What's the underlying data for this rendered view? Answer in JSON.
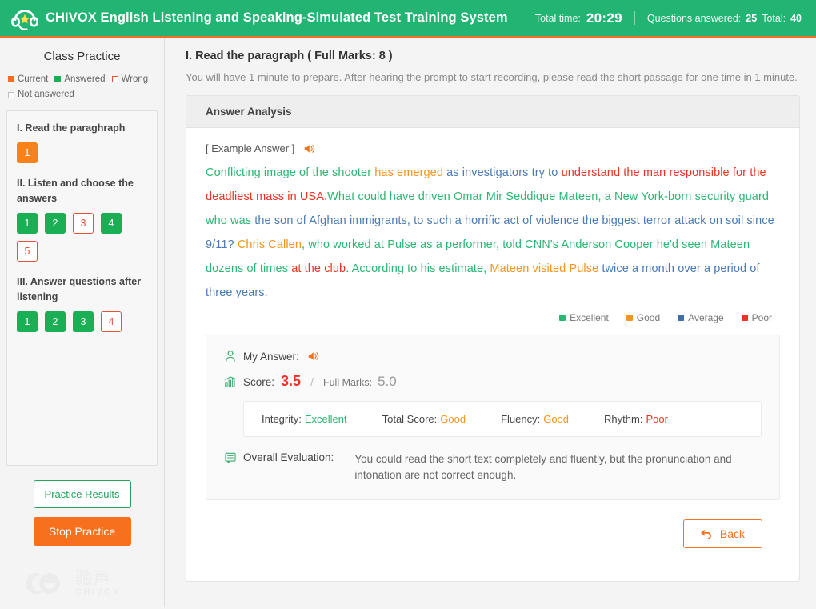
{
  "header": {
    "logo_icon": "headset-icon",
    "app_title": "CHIVOX English Listening and Speaking-Simulated Test Training System",
    "total_time_label": "Total time:",
    "total_time_value": "20:29",
    "questions_answered_label": "Questions answered:",
    "questions_answered_value": "25",
    "total_label": "Total:",
    "total_value": "40"
  },
  "sidebar": {
    "title": "Class Practice",
    "legend": [
      {
        "label": "Current",
        "style": "fill-cur"
      },
      {
        "label": "Answered",
        "style": "fill-ans"
      },
      {
        "label": "Wrong",
        "style": "out-wrong"
      },
      {
        "label": "Not answered",
        "style": "out-not"
      }
    ],
    "sections": [
      {
        "title": "I. Read the paraghraph",
        "questions": [
          {
            "n": "1",
            "state": "current"
          }
        ]
      },
      {
        "title": "II. Listen and choose the answers",
        "questions": [
          {
            "n": "1",
            "state": "answered"
          },
          {
            "n": "2",
            "state": "answered"
          },
          {
            "n": "3",
            "state": "wrong"
          },
          {
            "n": "4",
            "state": "answered"
          },
          {
            "n": "5",
            "state": "wrong"
          }
        ]
      },
      {
        "title": "III. Answer questions after listening",
        "questions": [
          {
            "n": "1",
            "state": "answered"
          },
          {
            "n": "2",
            "state": "answered"
          },
          {
            "n": "3",
            "state": "answered"
          },
          {
            "n": "4",
            "state": "wrong"
          }
        ]
      }
    ],
    "practice_results_label": "Practice Results",
    "stop_practice_label": "Stop Practice",
    "watermark_cn": "驰声",
    "watermark_en": "CHIVOX"
  },
  "main": {
    "question_heading": "I. Read the paragraph ( Full Marks: 8 )",
    "instruction": "You will have 1 minute to prepare. After hearing the prompt to start recording, please read the short passage for one time in 1 minute.",
    "analysis_title": "Answer Analysis",
    "example_label": "[ Example Answer ]",
    "example_speaker_icon": "speaker-icon",
    "passage_segments": [
      {
        "t": "Conflicting image of the shooter ",
        "c": "w-exc"
      },
      {
        "t": "has emerged ",
        "c": "w-good"
      },
      {
        "t": "as investigators try to ",
        "c": "w-avg"
      },
      {
        "t": "understand the man responsible for the deadliest mass in USA.",
        "c": "w-poor"
      },
      {
        "t": "What could have  driven Omar Mir Seddique Mateen",
        "c": "w-exc"
      },
      {
        "t": ", a New York-born security guard who was ",
        "c": "w-exc"
      },
      {
        "t": "the son of Afghan immigrants, to such a horrific act of violence the biggest terror attack on soil since 9/11? ",
        "c": "w-avg"
      },
      {
        "t": "Chris Callen",
        "c": "w-good"
      },
      {
        "t": ", who worked at Pulse as a performer, told CNN's Anderson Cooper he'd seen Mateen dozens of times ",
        "c": "w-exc"
      },
      {
        "t": "at the club",
        "c": "w-poor"
      },
      {
        "t": ". According to his estimate, ",
        "c": "w-exc"
      },
      {
        "t": "Mateen visited Pulse ",
        "c": "w-good"
      },
      {
        "t": "twice a month over a period of three years.",
        "c": "w-avg"
      }
    ],
    "color_legend": [
      {
        "label": "Excellent",
        "color": "#2bb673"
      },
      {
        "label": "Good",
        "color": "#f7941e"
      },
      {
        "label": "Average",
        "color": "#3e6fa8"
      },
      {
        "label": "Poor",
        "color": "#ee3124"
      }
    ],
    "my_answer_label": "My Answer:",
    "my_answer_icon": "person-icon",
    "my_answer_speaker_icon": "speaker-icon",
    "score_icon": "bar-chart-icon",
    "score_label": "Score:",
    "score_value": "3.5",
    "score_slash": "/",
    "full_marks_label": "Full Marks:",
    "full_marks_value": "5.0",
    "metrics": [
      {
        "label": "Integrity:",
        "value": "Excellent"
      },
      {
        "label": "Total Score:",
        "value": "Good"
      },
      {
        "label": "Fluency:",
        "value": "Good"
      },
      {
        "label": "Rhythm:",
        "value": "Poor"
      }
    ],
    "evaluation_icon": "comment-icon",
    "evaluation_label": "Overall Evaluation:",
    "evaluation_text": "You could read the short text completely and fluently, but the pronunciation and intonation are not correct enough.",
    "back_label": "Back",
    "back_icon": "back-arrow-icon"
  }
}
